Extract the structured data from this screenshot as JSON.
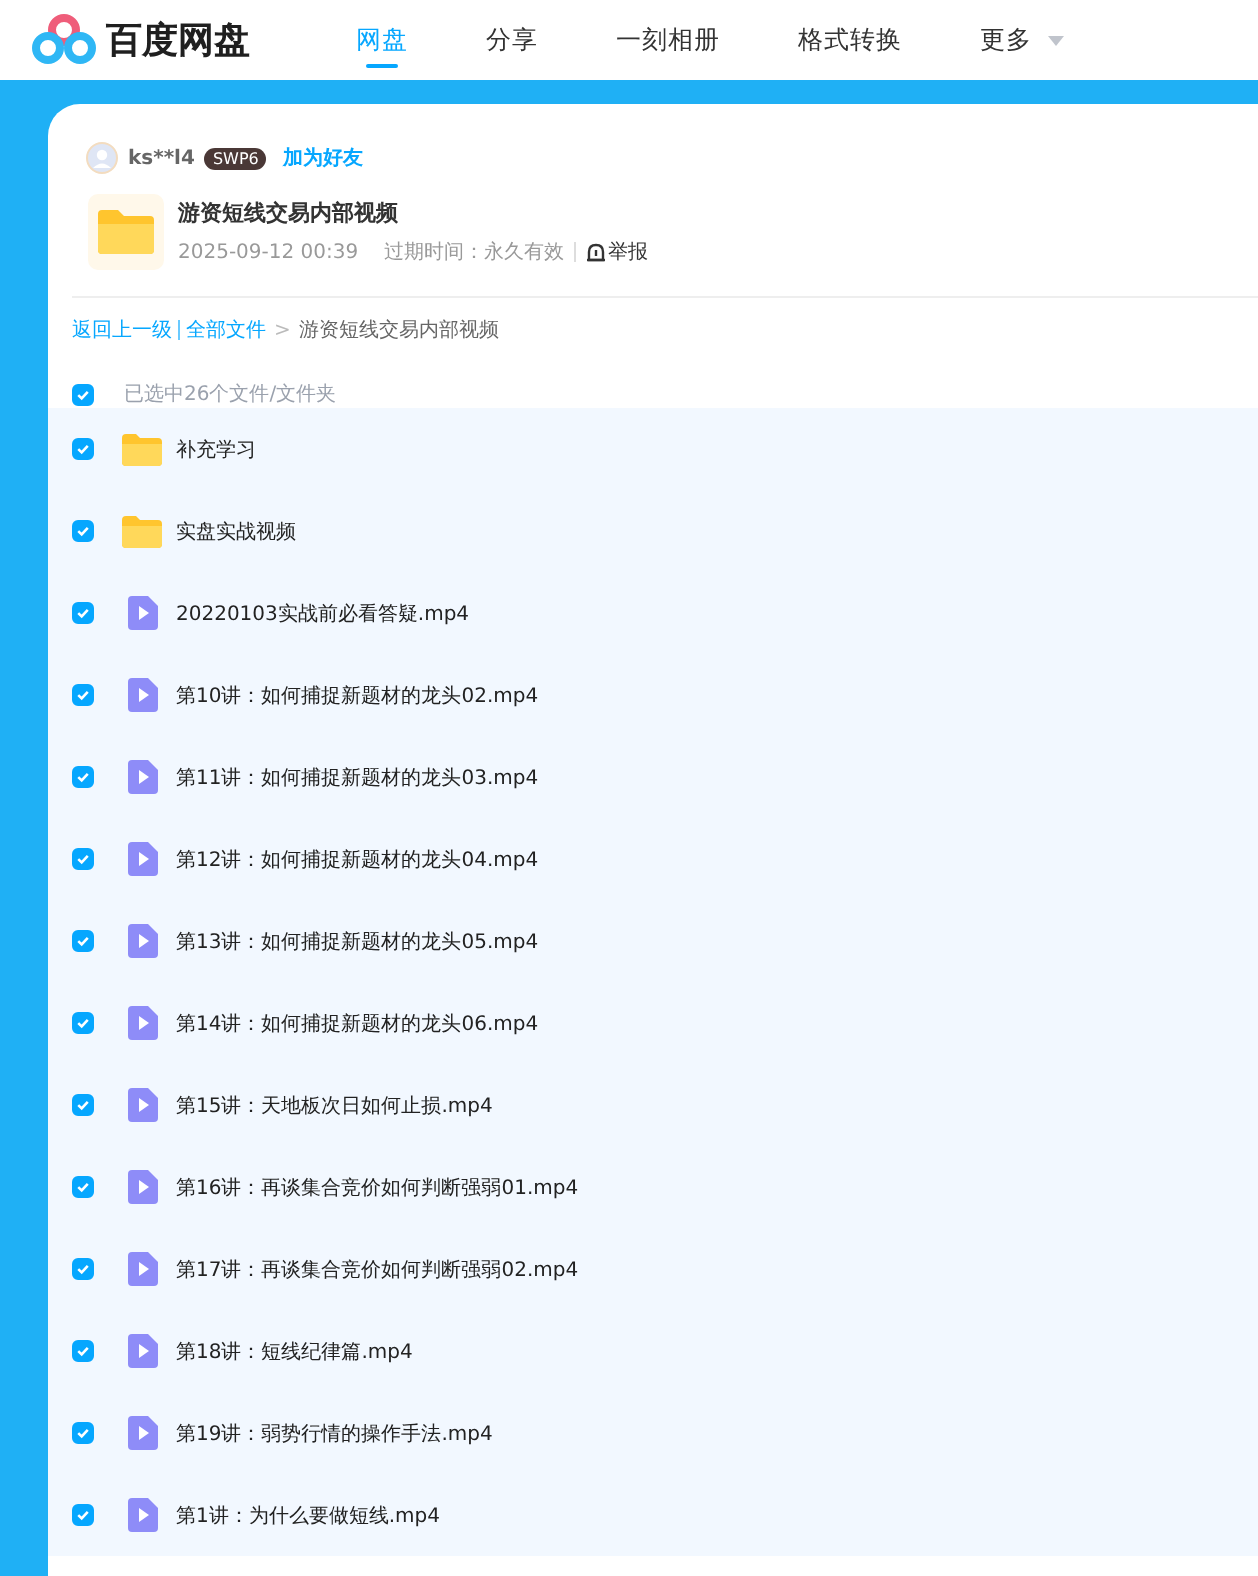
{
  "header": {
    "logo_text": "百度网盘",
    "nav": [
      {
        "label": "网盘",
        "selected": true,
        "dropdown": false
      },
      {
        "label": "分享",
        "selected": false,
        "dropdown": false
      },
      {
        "label": "一刻相册",
        "selected": false,
        "dropdown": false
      },
      {
        "label": "格式转换",
        "selected": false,
        "dropdown": false
      },
      {
        "label": "更多",
        "selected": false,
        "dropdown": true
      }
    ]
  },
  "share": {
    "user": {
      "name": "ks**l4",
      "badge": "SWP6",
      "add_friend": "加为好友"
    },
    "folder": {
      "title": "游资短线交易内部视频",
      "date": "2025-09-12 00:39",
      "expiry": "过期时间：永久有效",
      "report": "举报"
    },
    "breadcrumb": {
      "back": "返回上一级",
      "root": "全部文件",
      "separator": ">",
      "current": "游资短线交易内部视频"
    },
    "select_all": {
      "checked": true,
      "label": "已选中26个文件/文件夹"
    },
    "files": [
      {
        "kind": "folder",
        "name": "补充学习",
        "checked": true
      },
      {
        "kind": "folder",
        "name": "实盘实战视频",
        "checked": true
      },
      {
        "kind": "video",
        "name": "20220103实战前必看答疑.mp4",
        "checked": true
      },
      {
        "kind": "video",
        "name": "第10讲：如何捕捉新题材的龙头02.mp4",
        "checked": true
      },
      {
        "kind": "video",
        "name": "第11讲：如何捕捉新题材的龙头03.mp4",
        "checked": true
      },
      {
        "kind": "video",
        "name": "第12讲：如何捕捉新题材的龙头04.mp4",
        "checked": true
      },
      {
        "kind": "video",
        "name": "第13讲：如何捕捉新题材的龙头05.mp4",
        "checked": true
      },
      {
        "kind": "video",
        "name": "第14讲：如何捕捉新题材的龙头06.mp4",
        "checked": true
      },
      {
        "kind": "video",
        "name": "第15讲：天地板次日如何止损.mp4",
        "checked": true
      },
      {
        "kind": "video",
        "name": "第16讲：再谈集合竞价如何判断强弱01.mp4",
        "checked": true
      },
      {
        "kind": "video",
        "name": "第17讲：再谈集合竞价如何判断强弱02.mp4",
        "checked": true
      },
      {
        "kind": "video",
        "name": "第18讲：短线纪律篇.mp4",
        "checked": true
      },
      {
        "kind": "video",
        "name": "第19讲：弱势行情的操作手法.mp4",
        "checked": true
      },
      {
        "kind": "video",
        "name": "第1讲：为什么要做短线.mp4",
        "checked": true
      }
    ]
  }
}
